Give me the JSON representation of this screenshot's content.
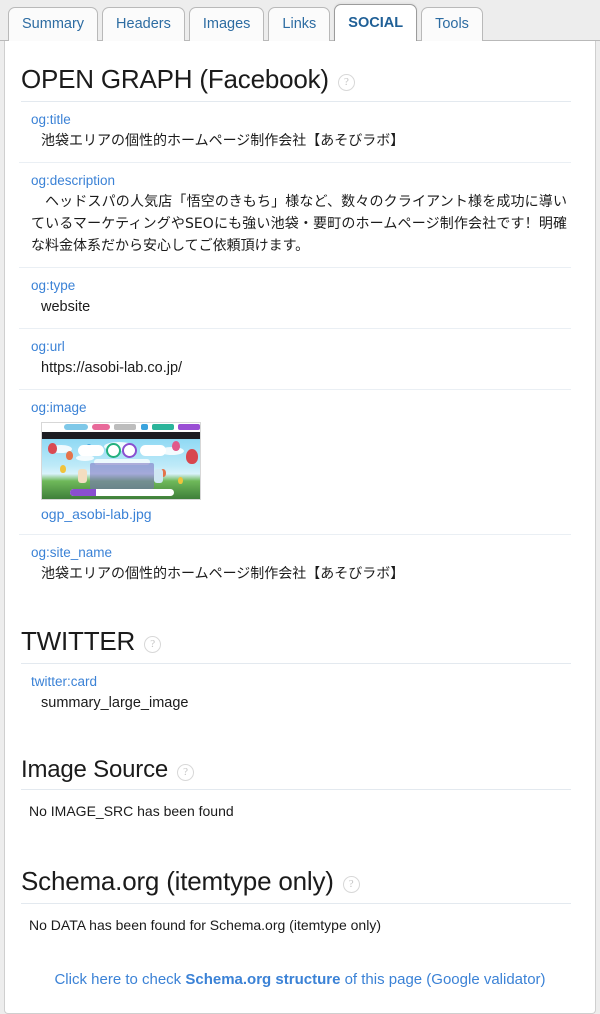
{
  "tabs": [
    {
      "label": "Summary",
      "active": false
    },
    {
      "label": "Headers",
      "active": false
    },
    {
      "label": "Images",
      "active": false
    },
    {
      "label": "Links",
      "active": false
    },
    {
      "label": "SOCIAL",
      "active": true
    },
    {
      "label": "Tools",
      "active": false
    }
  ],
  "help_glyph": "?",
  "sections": {
    "open_graph": {
      "title": "OPEN GRAPH (Facebook)",
      "rows": [
        {
          "key": "og:title",
          "value": "池袋エリアの個性的ホームページ制作会社【あそびラボ】"
        },
        {
          "key": "og:description",
          "value": "ヘッドスパの人気店「悟空のきもち」様など、数々のクライアント様を成功に導いているマーケティングやSEOにも強い池袋・要町のホームページ制作会社です！明確な料金体系だから安心してご依頼頂けます。"
        },
        {
          "key": "og:type",
          "value": "website"
        },
        {
          "key": "og:url",
          "value": "https://asobi-lab.co.jp/"
        },
        {
          "key": "og:image",
          "value": "ogp_asobi-lab.jpg"
        },
        {
          "key": "og:site_name",
          "value": "池袋エリアの個性的ホームページ制作会社【あそびラボ】"
        }
      ]
    },
    "twitter": {
      "title": "TWITTER",
      "rows": [
        {
          "key": "twitter:card",
          "value": "summary_large_image"
        }
      ]
    },
    "image_source": {
      "title": "Image Source",
      "message": "No IMAGE_SRC has been found"
    },
    "schema_org": {
      "title": "Schema.org (itemtype only)",
      "message": "No DATA has been found for Schema.org (itemtype only)"
    }
  },
  "footer": {
    "link_prefix": "Click here to check ",
    "link_bold": "Schema.org structure",
    "link_suffix": " of this page (Google validator)"
  },
  "colors": {
    "link": "#3b82d6",
    "tab_text": "#2d6ca2",
    "page_bg": "#ededed",
    "panel_bg": "#ffffff",
    "divider": "#eaeff4"
  }
}
